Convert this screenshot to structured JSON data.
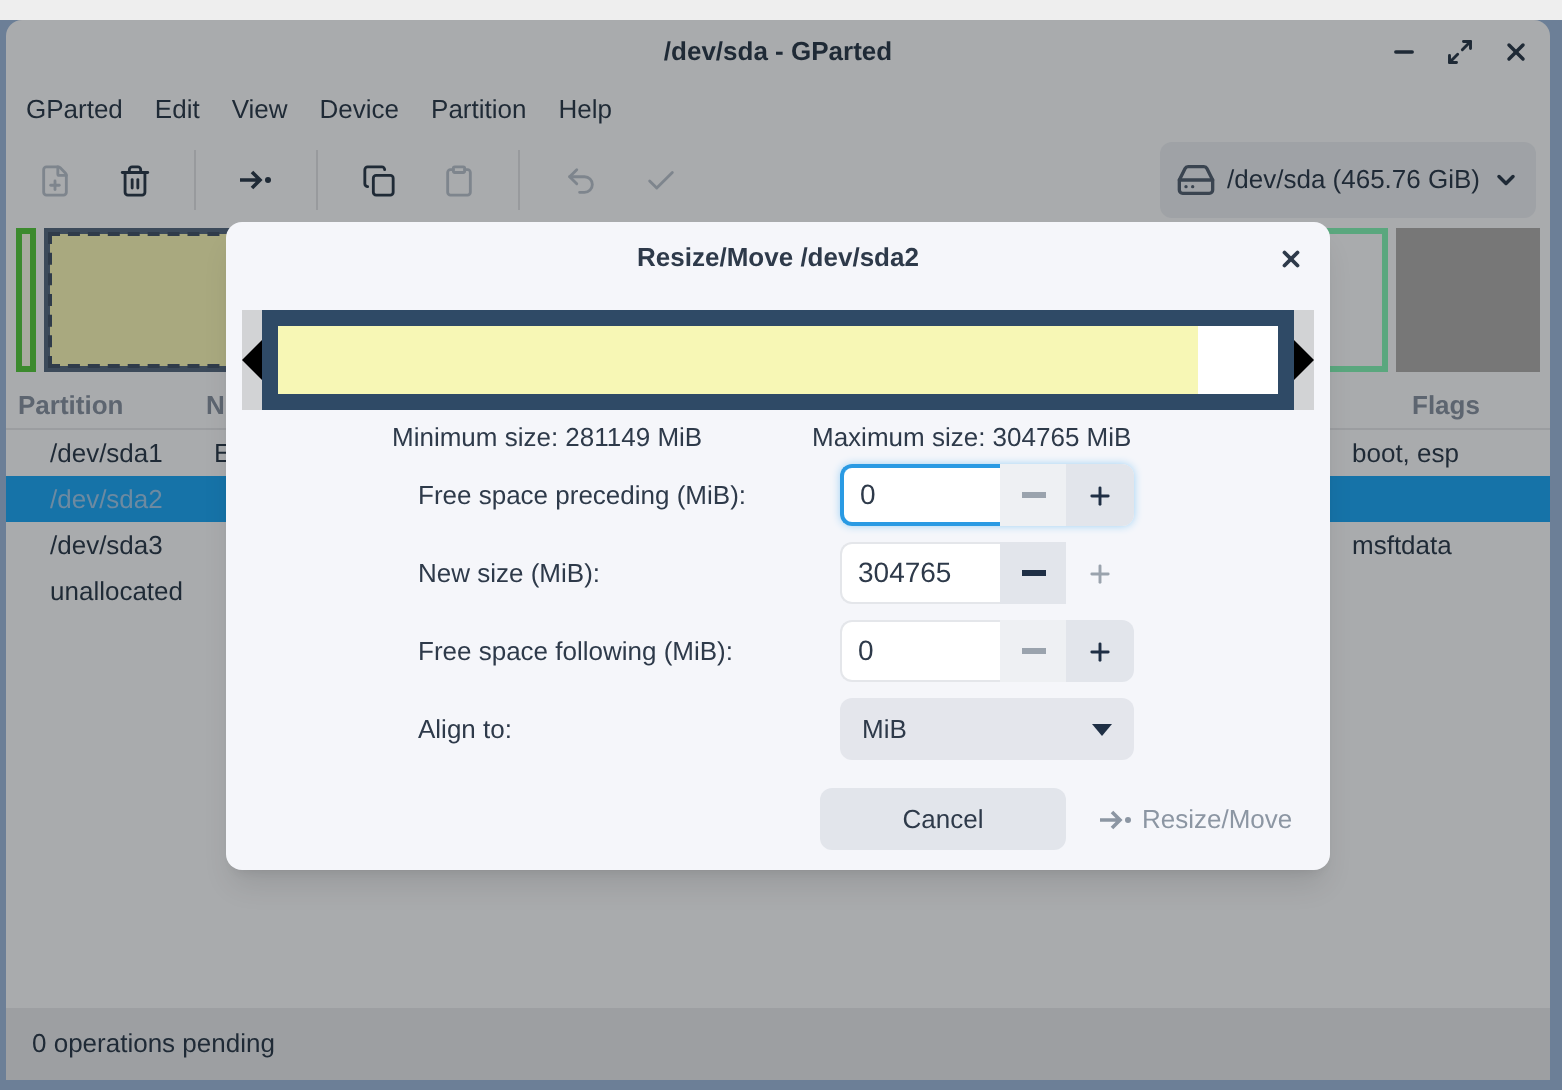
{
  "window": {
    "title": "/dev/sda - GParted"
  },
  "menu": [
    "GParted",
    "Edit",
    "View",
    "Device",
    "Partition",
    "Help"
  ],
  "toolbar": [
    {
      "kind": "new",
      "disabled": true
    },
    {
      "kind": "delete",
      "disabled": false
    },
    {
      "kind": "sep"
    },
    {
      "kind": "resize",
      "disabled": false
    },
    {
      "kind": "sep"
    },
    {
      "kind": "copy",
      "disabled": false
    },
    {
      "kind": "paste",
      "disabled": true
    },
    {
      "kind": "sep"
    },
    {
      "kind": "undo",
      "disabled": true
    },
    {
      "kind": "apply",
      "disabled": true
    }
  ],
  "device": {
    "label": "/dev/sda (465.76 GiB)"
  },
  "graph": [
    {
      "kind": "small",
      "selected": false,
      "color": "#3c8a2e"
    },
    {
      "kind": "wide",
      "selected": true,
      "color": "#a9a97f"
    },
    {
      "kind": "ntfs",
      "selected": false,
      "color": "#5aa77e"
    },
    {
      "kind": "free",
      "selected": false,
      "color": "#777777"
    }
  ],
  "table": {
    "columns": [
      "Partition",
      "N",
      "Flags"
    ],
    "rows": [
      {
        "cells": [
          "/dev/sda1",
          "E",
          "boot, esp"
        ],
        "selected": false
      },
      {
        "cells": [
          "/dev/sda2",
          "",
          ""
        ],
        "selected": true
      },
      {
        "cells": [
          "/dev/sda3",
          "",
          "msftdata"
        ],
        "selected": false
      },
      {
        "cells": [
          "unallocated",
          "",
          ""
        ],
        "selected": false
      }
    ]
  },
  "status_bar": "0 operations pending",
  "dialog": {
    "title": "Resize/Move /dev/sda2",
    "bar": {
      "level": 0.92
    },
    "min_size": "Minimum size: 281149 MiB",
    "max_size": "Maximum size: 304765 MiB",
    "fields": [
      {
        "label": "Free space preceding (MiB):",
        "value": "0",
        "focused": true,
        "minus_disabled": true,
        "plus_disabled": false
      },
      {
        "label": "New size (MiB):",
        "value": "304765",
        "focused": false,
        "minus_disabled": false,
        "plus_disabled": true
      },
      {
        "label": "Free space following (MiB):",
        "value": "0",
        "focused": false,
        "minus_disabled": true,
        "plus_disabled": false
      }
    ],
    "align": {
      "label": "Align to:",
      "value": "MiB"
    },
    "buttons": [
      {
        "label": "Cancel",
        "kind": "cancel",
        "disabled": false
      },
      {
        "label": "Resize/Move",
        "kind": "resize",
        "disabled": true
      }
    ]
  }
}
